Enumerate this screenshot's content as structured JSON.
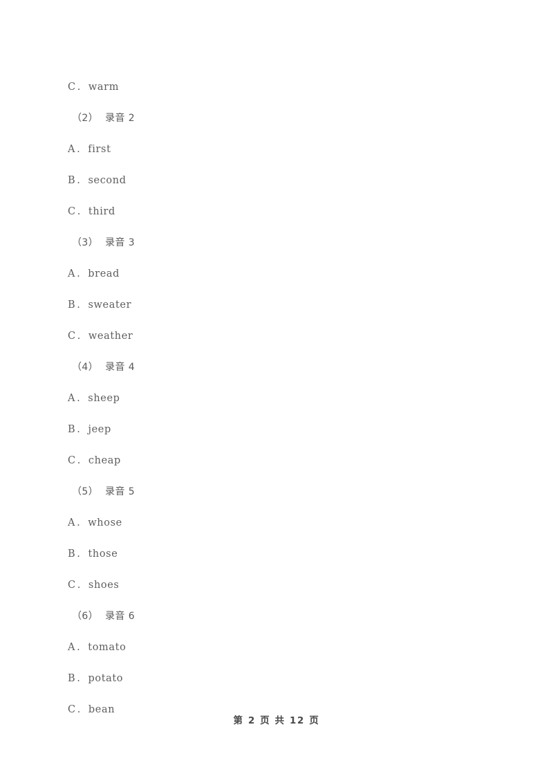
{
  "page": {
    "background_color": "#ffffff",
    "text_color": "#5d5d5d"
  },
  "blocks": [
    {
      "kind": "option",
      "letter": "C",
      "separator": ".",
      "word": "warm"
    },
    {
      "kind": "group",
      "number": "（2）",
      "label": "录音 2"
    },
    {
      "kind": "option",
      "letter": "A",
      "separator": ".",
      "word": "first"
    },
    {
      "kind": "option",
      "letter": "B",
      "separator": ".",
      "word": "second"
    },
    {
      "kind": "option",
      "letter": "C",
      "separator": ".",
      "word": "third"
    },
    {
      "kind": "group",
      "number": "（3）",
      "label": "录音 3"
    },
    {
      "kind": "option",
      "letter": "A",
      "separator": ".",
      "word": "bread"
    },
    {
      "kind": "option",
      "letter": "B",
      "separator": ".",
      "word": "sweater"
    },
    {
      "kind": "option",
      "letter": "C",
      "separator": ".",
      "word": "weather"
    },
    {
      "kind": "group",
      "number": "（4）",
      "label": "录音 4"
    },
    {
      "kind": "option",
      "letter": "A",
      "separator": ".",
      "word": "sheep"
    },
    {
      "kind": "option",
      "letter": "B",
      "separator": ".",
      "word": "jeep"
    },
    {
      "kind": "option",
      "letter": "C",
      "separator": ".",
      "word": "cheap"
    },
    {
      "kind": "group",
      "number": "（5）",
      "label": "录音 5"
    },
    {
      "kind": "option",
      "letter": "A",
      "separator": ".",
      "word": "whose"
    },
    {
      "kind": "option",
      "letter": "B",
      "separator": ".",
      "word": "those"
    },
    {
      "kind": "option",
      "letter": "C",
      "separator": ".",
      "word": "shoes"
    },
    {
      "kind": "group",
      "number": "（6）",
      "label": "录音 6"
    },
    {
      "kind": "option",
      "letter": "A",
      "separator": ".",
      "word": "tomato"
    },
    {
      "kind": "option",
      "letter": "B",
      "separator": ".",
      "word": "potato"
    },
    {
      "kind": "option",
      "letter": "C",
      "separator": ".",
      "word": "bean"
    }
  ],
  "footer": {
    "text": "第 2 页 共 12 页",
    "current_page": "2",
    "total_pages": "12"
  }
}
